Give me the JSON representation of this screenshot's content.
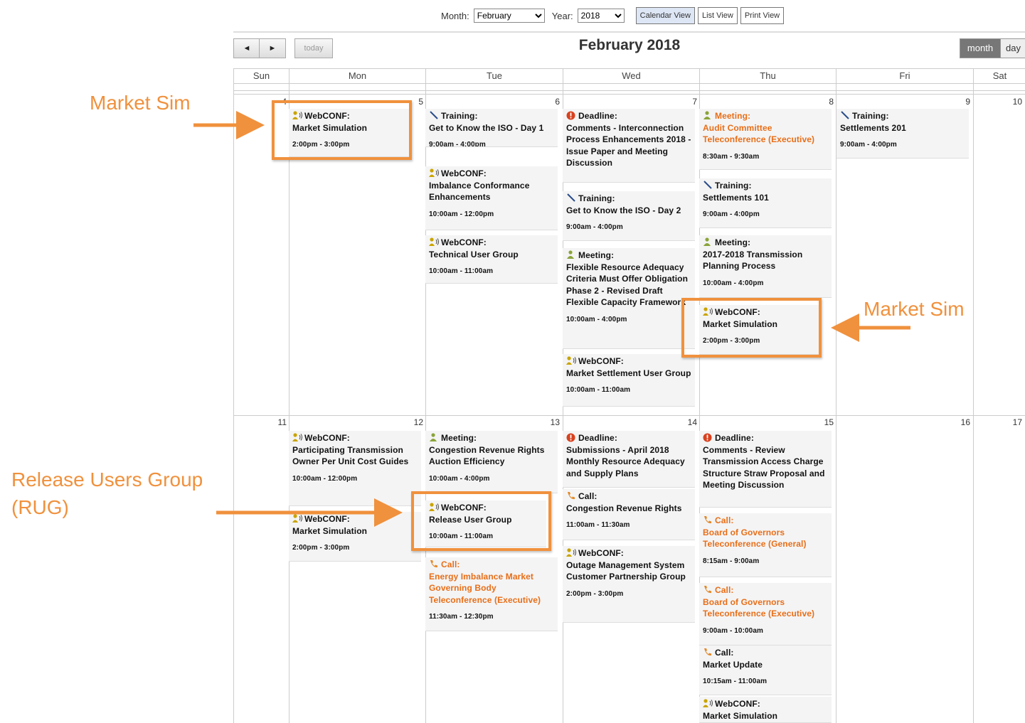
{
  "toolbar": {
    "month_label": "Month:",
    "month_value": "February",
    "year_label": "Year:",
    "year_value": "2018",
    "views": [
      "Calendar View",
      "List View",
      "Print View"
    ]
  },
  "nav": {
    "prev": "◄",
    "next": "►",
    "today": "today"
  },
  "calendar": {
    "title": "February 2018",
    "view_toggle": [
      "month",
      "day"
    ],
    "weekdays": [
      "Sun",
      "Mon",
      "Tue",
      "Wed",
      "Thu",
      "Fri",
      "Sat"
    ],
    "day_numbers_week1": [
      "4",
      "5",
      "6",
      "7",
      "8",
      "9",
      "10"
    ],
    "day_numbers_week2": [
      "11",
      "12",
      "13",
      "14",
      "15",
      "16",
      "17"
    ]
  },
  "events": [
    {
      "day": "Mon 5",
      "icon": "webconf-icon",
      "type": "WebCONF:",
      "title": "Market Simulation",
      "time": "2:00pm - 3:00pm"
    },
    {
      "day": "Tue 6",
      "icon": "training-icon",
      "type": "Training:",
      "title": "Get to Know the ISO - Day 1",
      "time": "9:00am - 4:00pm"
    },
    {
      "day": "Tue 6",
      "icon": "webconf-icon",
      "type": "WebCONF:",
      "title": "Imbalance Conformance Enhancements",
      "time": "10:00am - 12:00pm"
    },
    {
      "day": "Tue 6",
      "icon": "webconf-icon",
      "type": "WebCONF:",
      "title": "Technical User Group",
      "time": "10:00am - 11:00am"
    },
    {
      "day": "Wed 7",
      "icon": "deadline-icon",
      "type": "Deadline:",
      "title": "Comments - Interconnection Process Enhancements 2018 - Issue Paper and Meeting Discussion",
      "time": ""
    },
    {
      "day": "Wed 7",
      "icon": "training-icon",
      "type": "Training:",
      "title": "Get to Know the ISO - Day 2",
      "time": "9:00am - 4:00pm"
    },
    {
      "day": "Wed 7",
      "icon": "meeting-icon",
      "type": "Meeting:",
      "title": "Flexible Resource Adequacy Criteria Must Offer Obligation Phase 2 - Revised Draft Flexible Capacity Framework",
      "time": "10:00am - 4:00pm"
    },
    {
      "day": "Wed 7",
      "icon": "webconf-icon",
      "type": "WebCONF:",
      "title": "Market Settlement User Group",
      "time": "10:00am - 11:00am"
    },
    {
      "day": "Thu 8",
      "icon": "meeting-icon",
      "type": "Meeting:",
      "title": "Audit Committee Teleconference (Executive)",
      "time": "8:30am - 9:30am"
    },
    {
      "day": "Thu 8",
      "icon": "training-icon",
      "type": "Training:",
      "title": "Settlements 101",
      "time": "9:00am - 4:00pm"
    },
    {
      "day": "Thu 8",
      "icon": "meeting-icon",
      "type": "Meeting:",
      "title": "2017-2018 Transmission Planning Process",
      "time": "10:00am - 4:00pm"
    },
    {
      "day": "Thu 8",
      "icon": "webconf-icon",
      "type": "WebCONF:",
      "title": "Market Simulation",
      "time": "2:00pm - 3:00pm"
    },
    {
      "day": "Fri 9",
      "icon": "training-icon",
      "type": "Training:",
      "title": "Settlements 201",
      "time": "9:00am - 4:00pm"
    },
    {
      "day": "Mon 12",
      "icon": "webconf-icon",
      "type": "WebCONF:",
      "title": "Participating Transmission Owner Per Unit Cost Guides",
      "time": "10:00am - 12:00pm"
    },
    {
      "day": "Mon 12",
      "icon": "webconf-icon",
      "type": "WebCONF:",
      "title": "Market Simulation",
      "time": "2:00pm - 3:00pm"
    },
    {
      "day": "Tue 13",
      "icon": "meeting-icon",
      "type": "Meeting:",
      "title": "Congestion Revenue Rights Auction Efficiency",
      "time": "10:00am - 4:00pm"
    },
    {
      "day": "Tue 13",
      "icon": "webconf-icon",
      "type": "WebCONF:",
      "title": "Release User Group",
      "time": "10:00am - 11:00am"
    },
    {
      "day": "Tue 13",
      "icon": "call-icon",
      "type": "Call:",
      "title": "Energy Imbalance Market Governing Body Teleconference (Executive)",
      "time": "11:30am - 12:30pm"
    },
    {
      "day": "Wed 14",
      "icon": "deadline-icon",
      "type": "Deadline:",
      "title": "Submissions - April 2018 Monthly Resource Adequacy and Supply Plans",
      "time": ""
    },
    {
      "day": "Wed 14",
      "icon": "call-icon",
      "type": "Call:",
      "title": "Congestion Revenue Rights",
      "time": "11:00am - 11:30am"
    },
    {
      "day": "Wed 14",
      "icon": "webconf-icon",
      "type": "WebCONF:",
      "title": "Outage Management System Customer Partnership Group",
      "time": "2:00pm - 3:00pm"
    },
    {
      "day": "Thu 15",
      "icon": "deadline-icon",
      "type": "Deadline:",
      "title": "Comments - Review Transmission Access Charge Structure Straw Proposal and Meeting Discussion",
      "time": ""
    },
    {
      "day": "Thu 15",
      "icon": "call-icon",
      "type": "Call:",
      "title": "Board of Governors Teleconference (General)",
      "time": "8:15am - 9:00am"
    },
    {
      "day": "Thu 15",
      "icon": "call-icon",
      "type": "Call:",
      "title": "Board of Governors Teleconference (Executive)",
      "time": "9:00am - 10:00am"
    },
    {
      "day": "Thu 15",
      "icon": "call-icon",
      "type": "Call:",
      "title": "Market Update",
      "time": "10:15am - 11:00am"
    },
    {
      "day": "Thu 15",
      "icon": "webconf-icon",
      "type": "WebCONF:",
      "title": "Market Simulation",
      "time": ""
    }
  ],
  "annotations": {
    "label_left_top": "Market Sim",
    "label_right": "Market Sim",
    "label_rug_line1": "Release Users Group",
    "label_rug_line2": "(RUG)"
  },
  "colors": {
    "annotation": "#f0913d",
    "orange_event": "#e86e18",
    "webconf_icon": "#c9a400",
    "meeting_icon": "#8aa43a",
    "deadline_icon": "#d9411e",
    "call_icon": "#e38a2a"
  }
}
